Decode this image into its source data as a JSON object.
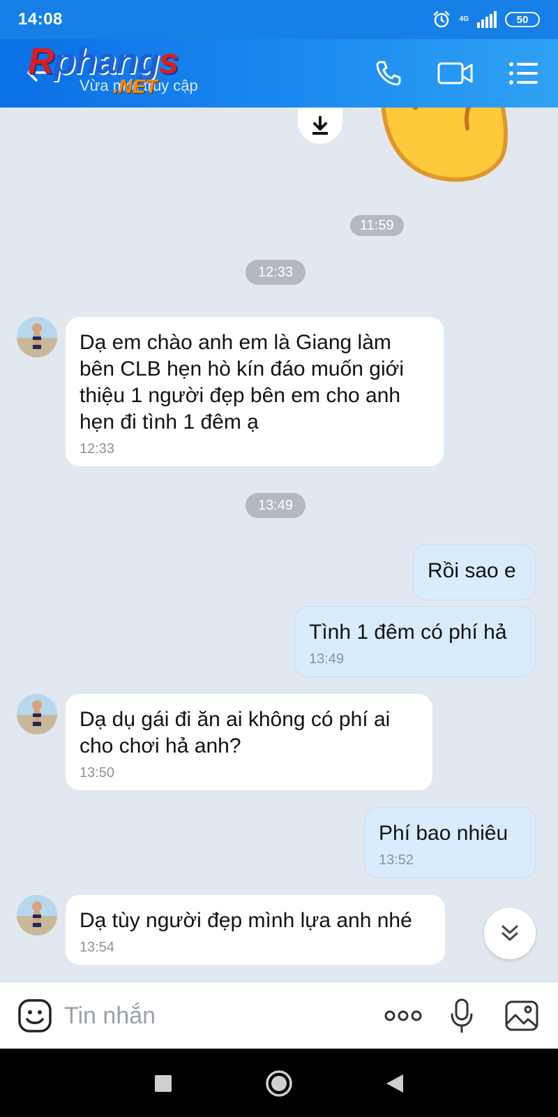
{
  "status_bar": {
    "time": "14:08",
    "network": "4G",
    "battery": "50"
  },
  "header": {
    "logo_part1": "R",
    "logo_part2": "phang",
    "logo_part3": "s",
    "logo_net": ".NET",
    "subtitle": "Vừa mới truy cập"
  },
  "chat": {
    "separators": [
      "11:59",
      "12:33",
      "13:49"
    ],
    "messages": [
      {
        "text": "Dạ em chào anh em là Giang làm\nbên CLB hẹn hò kín đáo muốn giới\nthiệu 1 người đẹp bên em cho anh\nhẹn đi tình 1 đêm ạ",
        "time": "12:33"
      },
      {
        "text": "Rồi sao e"
      },
      {
        "text": "Tình 1 đêm có phí hả",
        "time": "13:49"
      },
      {
        "text": "Dạ dụ gái đi ăn ai không có phí ai\ncho chơi hả anh?",
        "time": "13:50"
      },
      {
        "text": "Phí bao nhiêu",
        "time": "13:52"
      },
      {
        "text": "Dạ tùy người đẹp mình lựa anh nhé",
        "time": "13:54"
      }
    ]
  },
  "input": {
    "placeholder": "Tin nhắn"
  },
  "colors": {
    "header_blue": "#1680e6",
    "bubble_out": "#d8ecfd",
    "bubble_in": "#ffffff",
    "chat_bg": "#e2e8ef"
  }
}
